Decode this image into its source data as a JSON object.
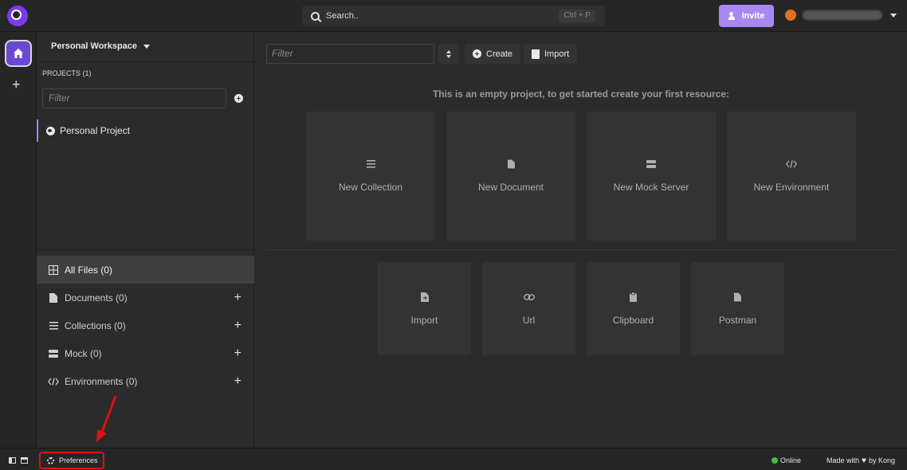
{
  "topbar": {
    "search_label": "Search..",
    "search_shortcut": "Ctrl + P",
    "invite_label": "Invite"
  },
  "sidebar": {
    "workspace": "Personal Workspace",
    "projects_header": "PROJECTS (1)",
    "filter_placeholder": "Filter",
    "project_name": "Personal Project",
    "nav": [
      {
        "label": "All Files (0)",
        "icon": "grid-icon"
      },
      {
        "label": "Documents (0)",
        "icon": "document-icon"
      },
      {
        "label": "Collections (0)",
        "icon": "list-icon"
      },
      {
        "label": "Mock (0)",
        "icon": "server-icon"
      },
      {
        "label": "Environments (0)",
        "icon": "code-icon"
      }
    ]
  },
  "main": {
    "filter_placeholder": "Filter",
    "create_label": "Create",
    "import_label": "Import",
    "empty_message": "This is an empty project, to get started create your first resource:",
    "create_cards": [
      {
        "label": "New Collection",
        "icon": "list-icon"
      },
      {
        "label": "New Document",
        "icon": "document-icon"
      },
      {
        "label": "New Mock Server",
        "icon": "server-icon"
      },
      {
        "label": "New Environment",
        "icon": "code-icon"
      }
    ],
    "import_cards": [
      {
        "label": "Import",
        "icon": "file-import-icon"
      },
      {
        "label": "Url",
        "icon": "link-icon"
      },
      {
        "label": "Clipboard",
        "icon": "clipboard-icon"
      },
      {
        "label": "Postman",
        "icon": "document-icon"
      }
    ]
  },
  "statusbar": {
    "preferences_label": "Preferences",
    "online_label": "Online",
    "made_with_label": "Made with",
    "by_label": "by Kong"
  },
  "colors": {
    "accent": "#a889f2",
    "annotation": "#e01010",
    "online": "#3cc43c"
  }
}
